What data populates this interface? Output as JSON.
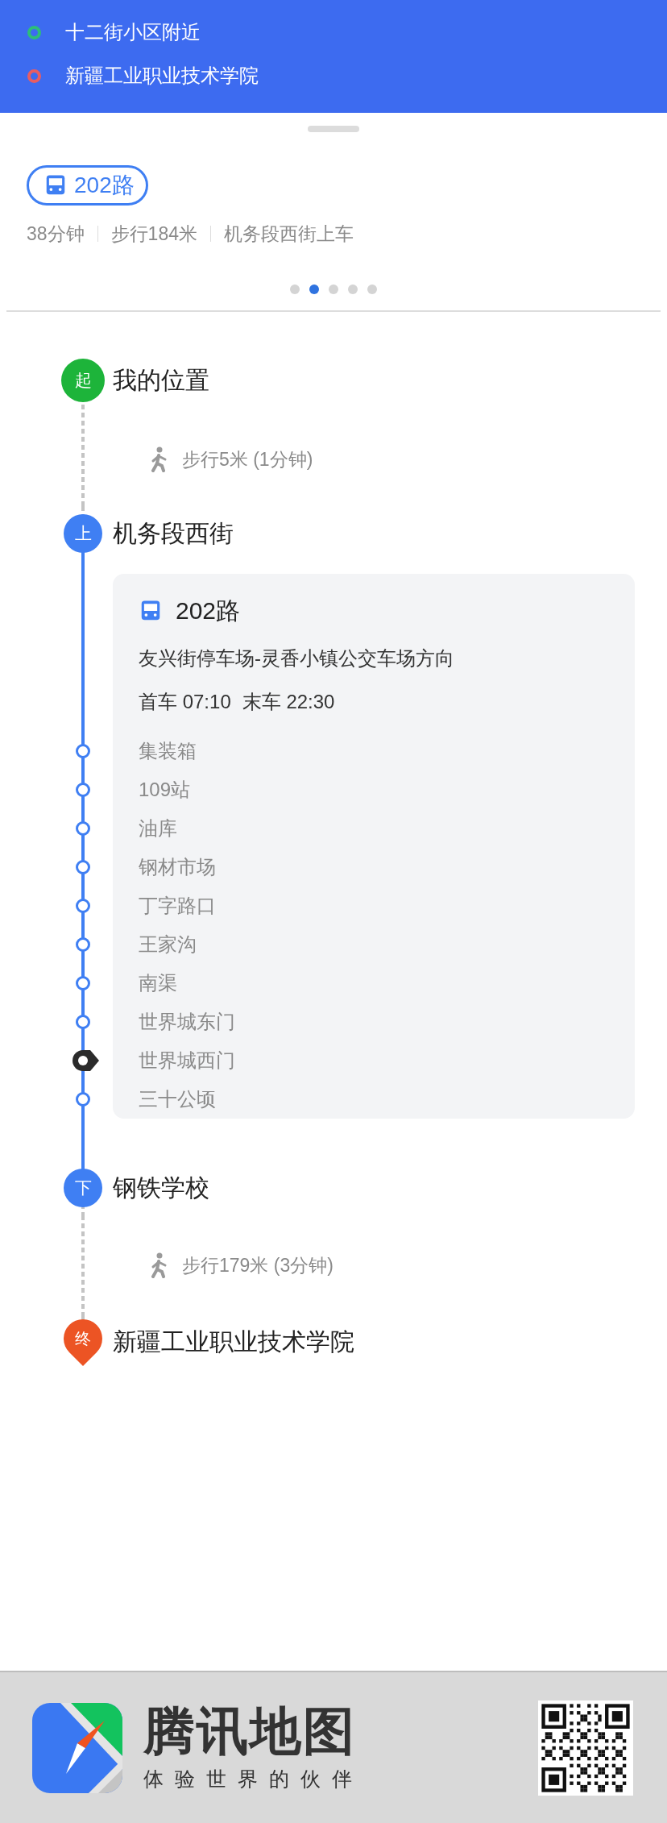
{
  "header": {
    "places": [
      {
        "name": "十二街小区附近",
        "color": "#2dbd7a"
      },
      {
        "name": "新疆工业职业技术学院",
        "color": "#e85d63"
      }
    ]
  },
  "summary": {
    "line": "202路",
    "facts": [
      "38分钟",
      "步行184米",
      "机务段西街上车"
    ],
    "pager": [
      {
        "selected": false
      },
      {
        "selected": true
      },
      {
        "selected": false
      },
      {
        "selected": false
      },
      {
        "selected": false
      }
    ]
  },
  "timeline": [
    {
      "kind": "start",
      "badge": "起",
      "name": "我的位置"
    },
    {
      "kind": "walk",
      "text": "步行5米 (1分钟)"
    },
    {
      "kind": "board",
      "badge": "上",
      "name": "机务段西街"
    },
    {
      "kind": "ride",
      "line": "202路",
      "direction": "友兴街停车场-灵香小镇公交车场方向",
      "times": [
        "首车 07:10",
        "末车 22:30"
      ],
      "stops": [
        {
          "name": "集装箱",
          "current": false
        },
        {
          "name": "109站",
          "current": false
        },
        {
          "name": "油库",
          "current": false
        },
        {
          "name": "钢材市场",
          "current": false
        },
        {
          "name": "丁字路口",
          "current": false
        },
        {
          "name": "王家沟",
          "current": false
        },
        {
          "name": "南渠",
          "current": false
        },
        {
          "name": "世界城东门",
          "current": false
        },
        {
          "name": "世界城西门",
          "current": true
        },
        {
          "name": "三十公顷",
          "current": false
        }
      ]
    },
    {
      "kind": "alight",
      "badge": "下",
      "name": "钢铁学校"
    },
    {
      "kind": "walk",
      "text": "步行179米 (3分钟)"
    },
    {
      "kind": "end",
      "badge": "终",
      "name": "新疆工业职业技术学院"
    }
  ],
  "footer": {
    "brand": "腾讯地图",
    "slogan": "体验世界的伙伴"
  }
}
